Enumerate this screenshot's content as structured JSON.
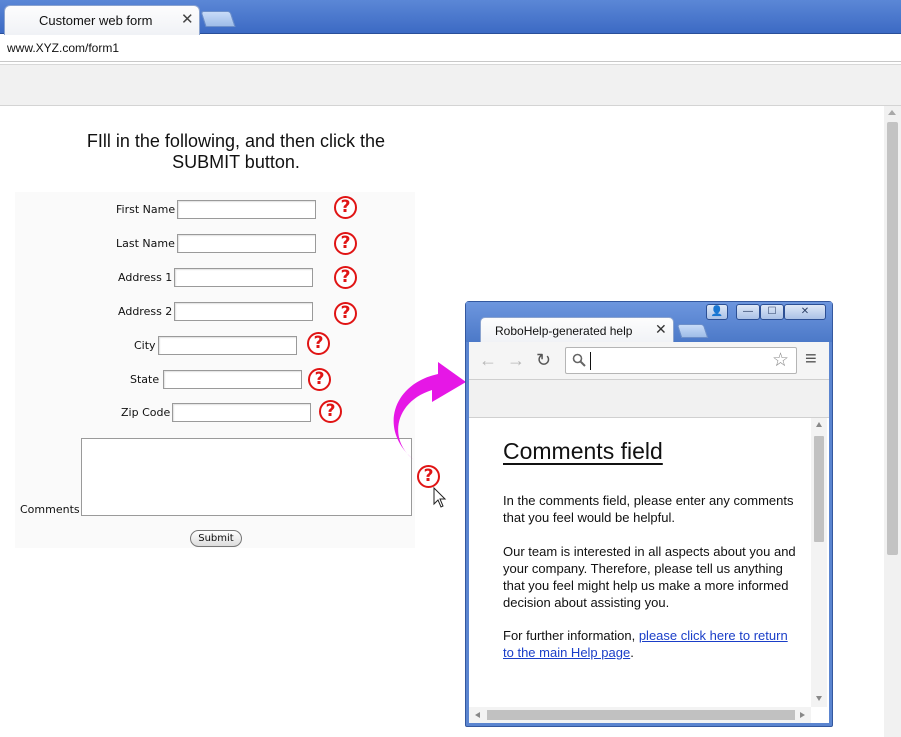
{
  "browser": {
    "tab_title": "Customer web form",
    "tab_close": "✕",
    "url": "www.XYZ.com/form1"
  },
  "form": {
    "instructions": "FIll in the following, and then click the SUBMIT button.",
    "fields": {
      "first_name": "First Name",
      "last_name": "Last Name",
      "address1": "Address 1",
      "address2": "Address 2",
      "city": "City",
      "state": "State",
      "zip": "Zip Code",
      "comments": "Comments"
    },
    "help_glyph": "?",
    "submit_label": "Submit"
  },
  "help_window": {
    "tab_title": "RoboHelp-generated help",
    "tab_close": "✕",
    "heading": "Comments field",
    "para1": "In the comments field, please enter any comments that you feel would be helpful.",
    "para2": "Our team is interested in all aspects about you and your company. Therefore, please tell us anything that you feel might help us make a more informed decision about assisting you.",
    "para3_prefix": "For further information, ",
    "para3_link": "please click here to return to the main Help page",
    "para3_suffix": ".",
    "window_buttons": {
      "user": "👤",
      "minimize": "—",
      "maximize": "☐",
      "close": "✕"
    },
    "nav": {
      "back": "←",
      "forward": "→",
      "reload": "↻",
      "star": "☆",
      "menu": "≡"
    }
  },
  "colors": {
    "help_icon": "#e01414",
    "arrow": "#e617e6",
    "link": "#1a3ec8",
    "chrome_blue": "#4a77c8"
  }
}
